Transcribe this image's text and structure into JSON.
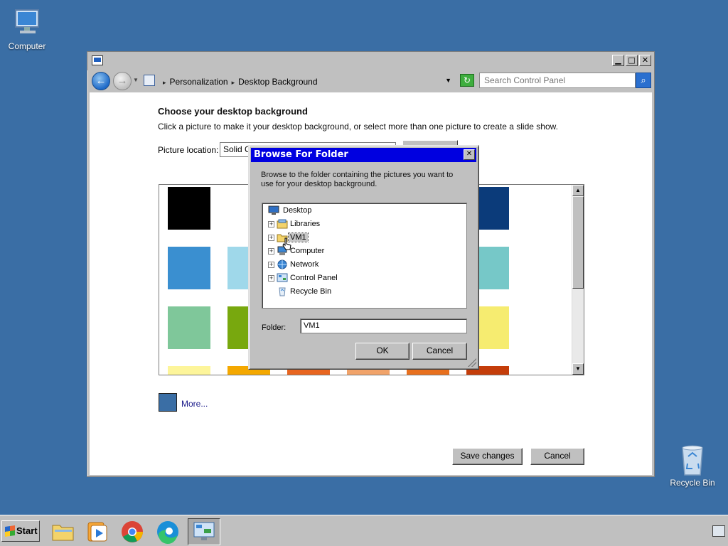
{
  "desktop": {
    "icons": [
      {
        "label": "Computer"
      },
      {
        "label": "Recycle Bin"
      }
    ]
  },
  "window": {
    "controls": {
      "minimize": "▁",
      "maximize": "□",
      "close": "✕"
    },
    "nav": {
      "back": "←",
      "forward": "→"
    },
    "breadcrumbs": [
      "Personalization",
      "Desktop Background"
    ],
    "refresh": "↻",
    "search_placeholder": "Search Control Panel",
    "search_icon": "⌕"
  },
  "content": {
    "heading": "Choose your desktop background",
    "subtext": "Click a picture to make it your desktop background, or select more than one picture to create a slide show.",
    "picture_location_label": "Picture location:",
    "picture_location_value": "Solid Co",
    "more_link": "More...",
    "save_button": "Save changes",
    "cancel_button": "Cancel",
    "swatch_colors": [
      "#000000",
      "#0b3b7a",
      "#3a8fd0",
      "#9fd8ea",
      "#76c8c8",
      "#7fc79a",
      "#78a80e",
      "#f6ec70",
      "#fdf59a",
      "#f4a800",
      "#e86520",
      "#f1a36a",
      "#e8701e",
      "#c43d0a"
    ]
  },
  "dialog": {
    "title": "Browse For Folder",
    "close": "✕",
    "description": "Browse to the folder containing the pictures you want to use for your desktop background.",
    "tree": [
      {
        "label": "Desktop",
        "icon": "desktop-icon"
      },
      {
        "label": "Libraries",
        "icon": "libraries-icon"
      },
      {
        "label": "VM1",
        "icon": "user-folder-icon"
      },
      {
        "label": "Computer",
        "icon": "computer-icon"
      },
      {
        "label": "Network",
        "icon": "network-icon"
      },
      {
        "label": "Control Panel",
        "icon": "control-panel-icon"
      },
      {
        "label": "Recycle Bin",
        "icon": "recycle-bin-icon"
      }
    ],
    "folder_label": "Folder:",
    "folder_value": "VM1",
    "ok": "OK",
    "cancel": "Cancel"
  },
  "taskbar": {
    "start": "Start",
    "apps": [
      "file-explorer-icon",
      "media-player-icon",
      "chrome-icon",
      "edge-icon",
      "control-panel-icon"
    ]
  }
}
